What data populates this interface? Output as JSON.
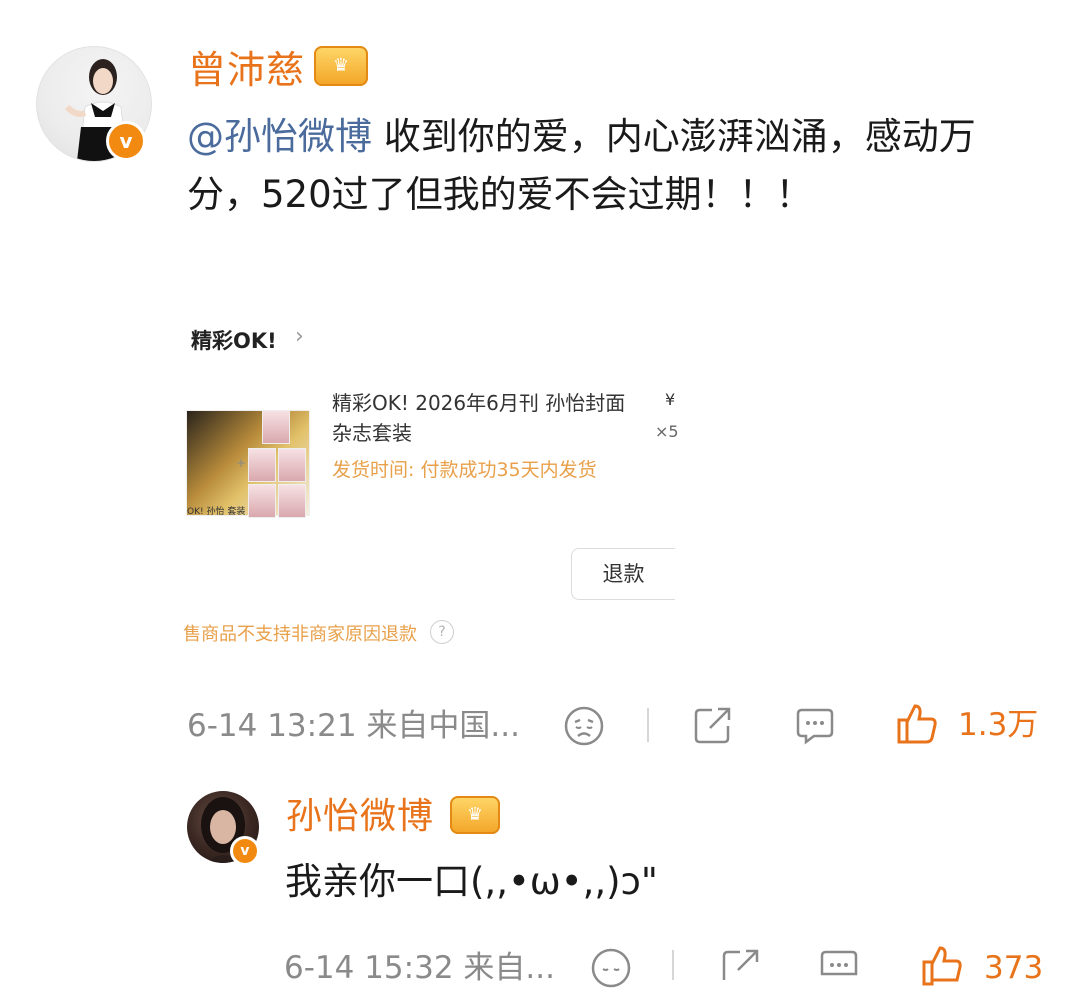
{
  "post": {
    "author": "曾沛慈",
    "mention": "@孙怡微博",
    "text": "收到你的爱，内心澎湃汹涌，感动万分，520过了但我的爱不会过期！！！",
    "shop": {
      "title": "精彩OK!",
      "product_name": "精彩OK! 2026年6月刊 孙怡封面杂志套装",
      "shipping": "发货时间: 付款成功35天内发货",
      "price_fragment": "¥",
      "qty_fragment": "×5",
      "refund_label": "退款",
      "notice": "售商品不支持非商家原因退款"
    },
    "meta": "6-14 13:21  来自中国...",
    "likes": "1.3万"
  },
  "reply": {
    "author": "孙怡微博",
    "text": "我亲你一口(,,•ω•,,)ɔ\"",
    "meta": "6-14 15:32  来自...",
    "likes": "373"
  },
  "colors": {
    "accent": "#e8731a",
    "mention": "#4a6b9c",
    "shipping": "#e8a04a",
    "meta": "#8a8a8a",
    "badge": "#f28a11"
  },
  "icons": [
    "verified-badge-icon",
    "crown-badge-icon",
    "chevron-right-icon",
    "help-icon",
    "dislike-face-icon",
    "share-icon",
    "comment-icon",
    "thumbs-up-icon"
  ]
}
